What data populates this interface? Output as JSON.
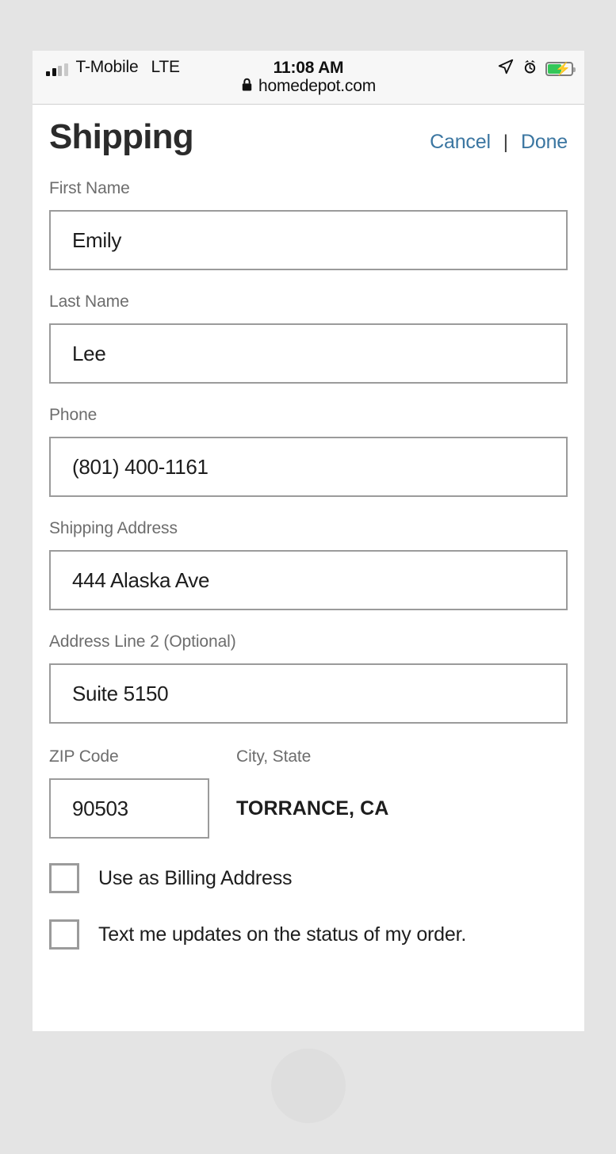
{
  "status_bar": {
    "carrier": "T-Mobile",
    "network": "LTE",
    "time": "11:08 AM",
    "url": "homedepot.com",
    "icons": {
      "signal": "signal-bars-icon",
      "location": "location-arrow-icon",
      "alarm": "alarm-clock-icon",
      "battery": "battery-charging-icon",
      "lock": "lock-icon"
    },
    "battery_level_percent": 55
  },
  "header": {
    "title": "Shipping",
    "cancel_label": "Cancel",
    "separator": "|",
    "done_label": "Done",
    "link_color": "#3b76a1"
  },
  "form": {
    "fields": [
      {
        "label": "First Name",
        "value": "Emily",
        "placeholder": "First Name"
      },
      {
        "label": "Last Name",
        "value": "Lee",
        "placeholder": "Last Name"
      },
      {
        "label": "Phone",
        "value": "(801) 400-1161",
        "placeholder": "Phone"
      },
      {
        "label": "Shipping Address",
        "value": "444 Alaska Ave",
        "placeholder": "Shipping Address"
      },
      {
        "label": "Address Line 2 (Optional)",
        "value": "Suite 5150",
        "placeholder": "Address Line 2"
      }
    ],
    "zip": {
      "label": "ZIP Code",
      "value": "90503",
      "placeholder": "ZIP Code"
    },
    "city_state": {
      "label": "City, State",
      "value": "TORRANCE, CA"
    },
    "checkboxes": [
      {
        "label": "Use as Billing Address",
        "checked": false
      },
      {
        "label": "Text me updates on the status of my order.",
        "checked": false
      }
    ]
  }
}
